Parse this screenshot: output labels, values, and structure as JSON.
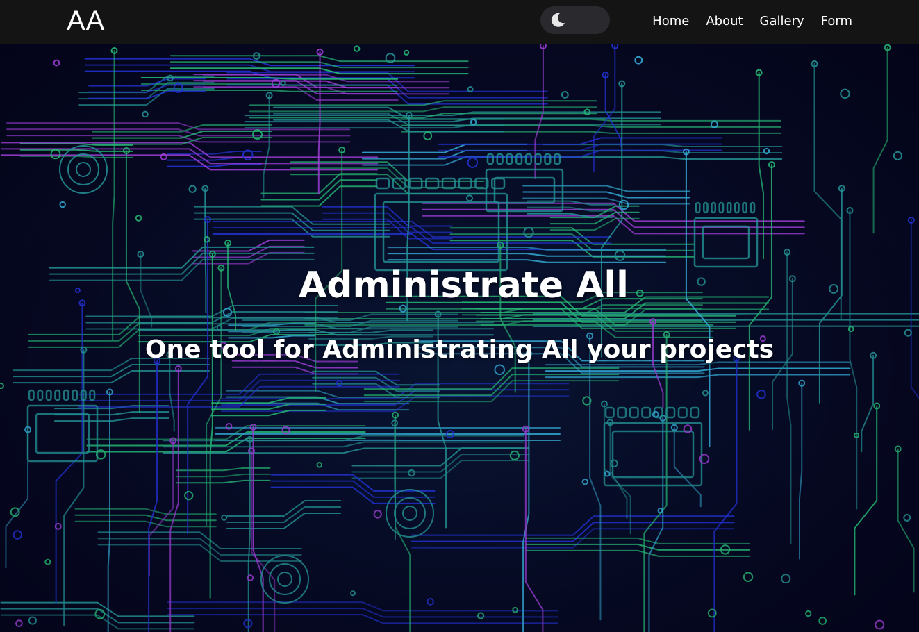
{
  "navbar": {
    "logo": "AA",
    "theme_toggle": {
      "icon": "moon-icon",
      "state": "dark"
    },
    "links": [
      {
        "label": "Home"
      },
      {
        "label": "About"
      },
      {
        "label": "Gallery"
      },
      {
        "label": "Form"
      }
    ]
  },
  "hero": {
    "title": "Administrate All",
    "subtitle": "One tool for Administrating All your projects",
    "background": "circuit-board-image"
  },
  "colors": {
    "navbar_bg": "#141414",
    "text": "#ffffff",
    "hero_bg": "#070a24",
    "circuit_green": "#2ee08a",
    "circuit_teal": "#2bb3b0",
    "circuit_blue": "#2a3cff"
  }
}
